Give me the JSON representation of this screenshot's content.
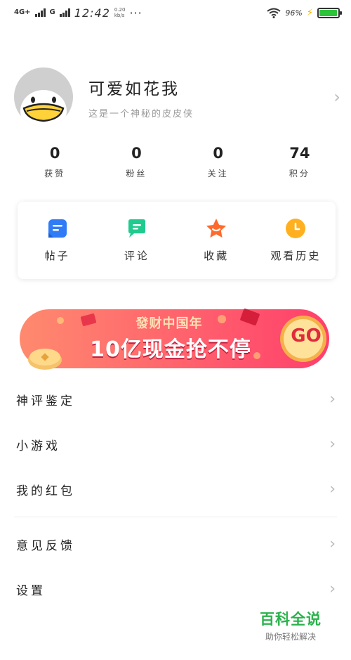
{
  "status_bar": {
    "network_1": "4G+",
    "network_2": "G",
    "time": "12:42",
    "speed_value": "0.20",
    "speed_unit": "kb/s",
    "more": "···",
    "battery_percent": "96%",
    "battery_level": 0.96,
    "icons": [
      "signal-icon",
      "wifi-icon",
      "charging-icon",
      "battery-icon"
    ]
  },
  "profile": {
    "username": "可爱如花我",
    "bio": "这是一个神秘的皮皮侠",
    "avatar_icon": "duck-avatar"
  },
  "stats": [
    {
      "value": "0",
      "label": "获赞"
    },
    {
      "value": "0",
      "label": "粉丝"
    },
    {
      "value": "0",
      "label": "关注"
    },
    {
      "value": "74",
      "label": "积分"
    }
  ],
  "quick_actions": [
    {
      "label": "帖子",
      "icon": "post-icon",
      "color": "#2f7cf6"
    },
    {
      "label": "评论",
      "icon": "comment-icon",
      "color": "#1fcb8e"
    },
    {
      "label": "收藏",
      "icon": "star-icon",
      "color": "#ff6a2c"
    },
    {
      "label": "观看历史",
      "icon": "clock-icon",
      "color": "#ffb020"
    }
  ],
  "banner": {
    "subtitle": "發财中国年",
    "title": "10亿现金抢不停",
    "cta": "GO"
  },
  "menu_group_1": [
    {
      "label": "神评鉴定"
    },
    {
      "label": "小游戏"
    },
    {
      "label": "我的红包"
    }
  ],
  "menu_group_2": [
    {
      "label": "意见反馈"
    },
    {
      "label": "设置"
    }
  ],
  "watermark": {
    "title": "百科全说",
    "subtitle": "助你轻松解决"
  },
  "colors": {
    "accent_green": "#2bb24c",
    "banner_start": "#ff7a6b",
    "banner_end": "#ff3f6c",
    "battery_green": "#2dc43b"
  }
}
